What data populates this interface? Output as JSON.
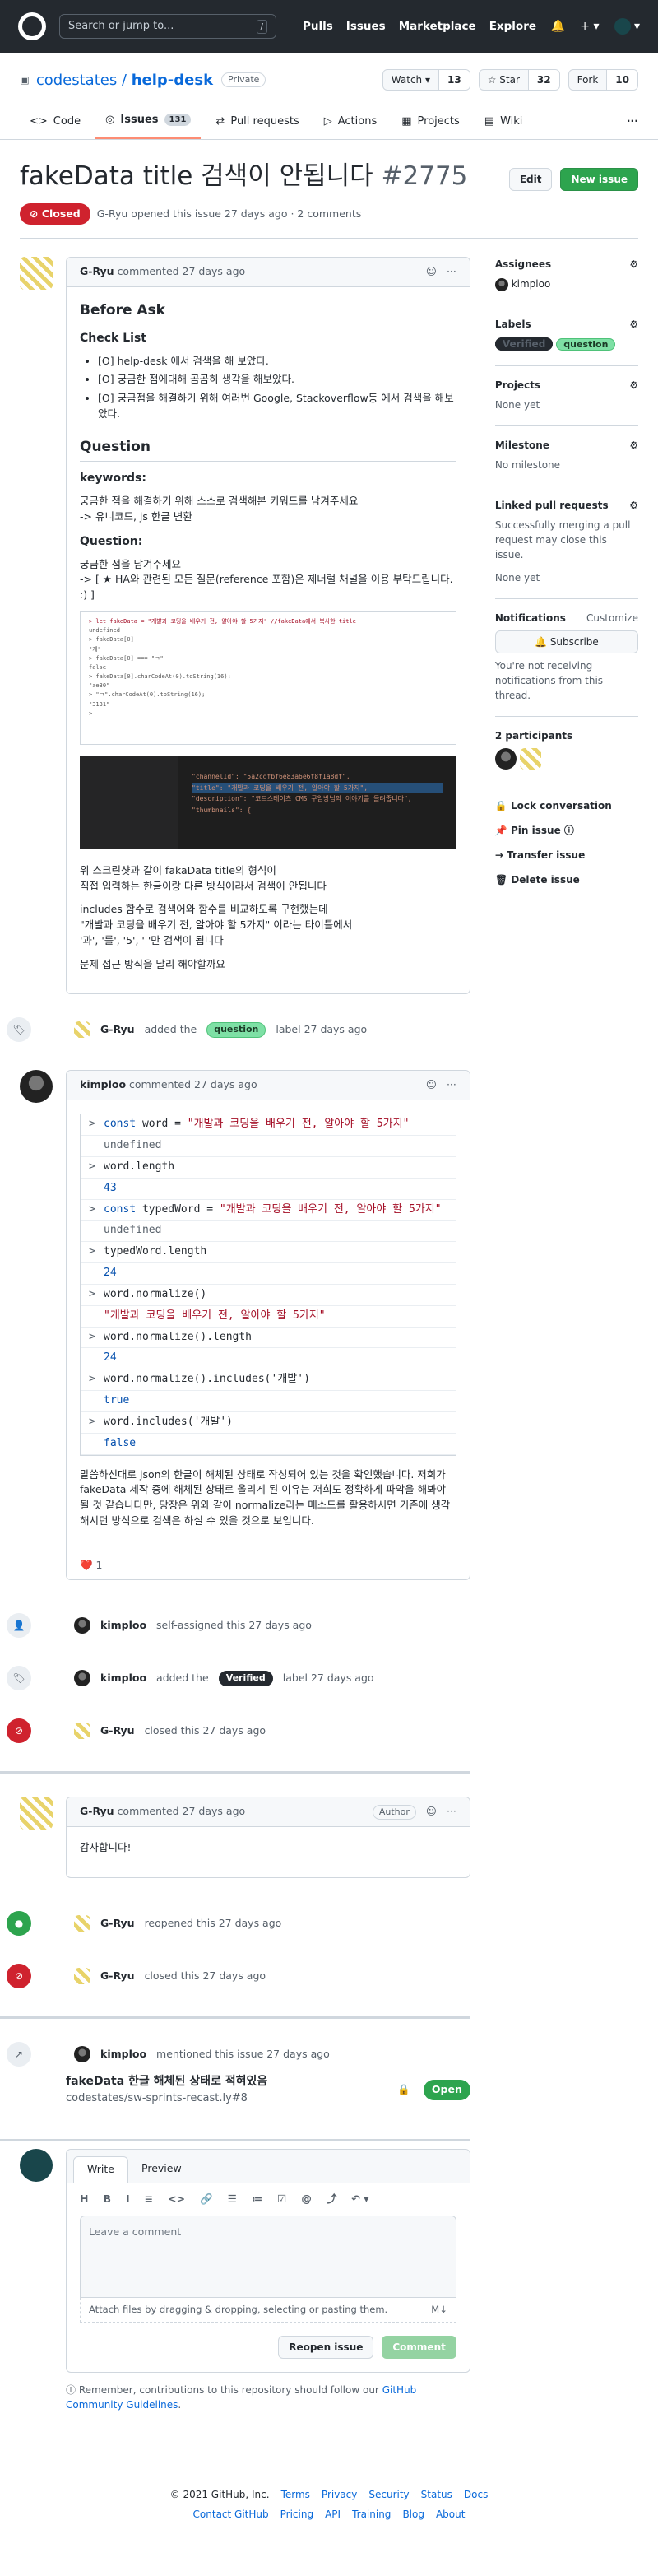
{
  "header": {
    "search_placeholder": "Search or jump to...",
    "search_key": "/",
    "nav": [
      "Pulls",
      "Issues",
      "Marketplace",
      "Explore"
    ],
    "right": [
      "🔔",
      "+ ▾",
      "▾"
    ]
  },
  "repo": {
    "owner": "codestates",
    "slash": " / ",
    "name": "help-desk",
    "visibility": "Private",
    "watch": "Watch ▾",
    "watch_count": "13",
    "star": "☆ Star",
    "star_count": "32",
    "fork": "Fork",
    "fork_count": "10"
  },
  "tabs": [
    {
      "label": "Code"
    },
    {
      "label": "Issues",
      "count": "131"
    },
    {
      "label": "Pull requests"
    },
    {
      "label": "Actions"
    },
    {
      "label": "Projects"
    },
    {
      "label": "Wiki"
    }
  ],
  "tab_icons": [
    "<>",
    "◎",
    "⇄",
    "▷",
    "▦",
    "▤"
  ],
  "more": "···",
  "issue": {
    "title": "fakeData title 검색이 안됩니다",
    "number": "#2775",
    "edit": "Edit",
    "new_issue": "New issue",
    "state": "Closed",
    "opened_text": "G-Ryu opened this issue 27 days ago · 2 comments"
  },
  "comment1": {
    "author": "G-Ryu",
    "time": "commented 27 days ago",
    "more": "···",
    "smile": "☺",
    "h_before": "Before Ask",
    "h_checklist": "Check List",
    "checklist": [
      "[O] help-desk 에서 검색을 해 보았다.",
      "[O] 궁금한 점에대해 곰곰히 생각을 해보았다.",
      "[O] 궁금점을 해결하기 위해 여러번 Google, Stackoverflow등 에서 검색을 해보았다."
    ],
    "h_question": "Question",
    "kw_label": "keywords:",
    "kw_line1": "궁금한 점을 해결하기 위해 스스로 검색해본 키워드를 남겨주세요",
    "kw_line2": "-> 유니코드, js 한글 변환",
    "q_label": "Question:",
    "q_line1": "궁금한 점을 남겨주세요",
    "q_line2": "-> [ ★ HA와 관련된 모든 질문(reference 포함)은 제너럴 채널을 이용 부탁드립니다. :) ]",
    "img1_lines": [
      "> let fakeData = \"개발과 코딩을 배우기 전, 알아야 할 5가지\" //fakeData에서 복사한 title",
      "  undefined",
      "> fakeData[0]",
      "  \"개\"",
      "> fakeData[0] === \"ㄱ\"",
      "  false",
      "> fakeData[0].charCodeAt(0).toString(16);",
      "  \"ae30\"",
      "> \"ㄱ\".charCodeAt(0).toString(16);",
      "  \"3131\"",
      ">"
    ],
    "img2_lines": [
      "\"channelId\": \"5a2cdfbf6e83a6e6f8f1a8df\",",
      "\"title\": \"개발과 코딩을 배우기 전, 알아야 할 5가지\",",
      "\"description\": \"코드스테이츠 CMS 구임방님의 이야기를 들려줍니다\",",
      "\"thumbnails\": {"
    ],
    "p1": "위 스크린샷과 같이 fakaData title의 형식이",
    "p2": "직접 입력하는 한글이랑 다른 방식이라서 검색이 안됩니다",
    "p3": "includes 함수로 검색어와 함수를 비교하도록 구현했는데",
    "p4": "\"개발과 코딩을 배우기 전, 알아야 할 5가지\" 이라는 타이틀에서",
    "p5": "'과', '를', '5', ' '만 검색이 됩니다",
    "p6": "문제 접근 방식을 달리 해야할까요"
  },
  "event_label1": {
    "icon": "🏷",
    "user": "G-Ryu",
    "pre": "added the",
    "label": "question",
    "post": "label 27 days ago"
  },
  "comment2": {
    "author": "kimploo",
    "time": "commented 27 days ago",
    "more": "···",
    "smile": "☺",
    "console": [
      {
        "k": "in",
        "p": ">",
        "t1": "const ",
        "t2": "word = ",
        "t3": "\"개발과 코딩을 배우기 전, 알아야 할 5가지\""
      },
      {
        "k": "out",
        "p": "",
        "t": "undefined"
      },
      {
        "k": "in",
        "p": ">",
        "t": "word.length"
      },
      {
        "k": "num",
        "p": "",
        "t": "43"
      },
      {
        "k": "in",
        "p": ">",
        "t1": "const ",
        "t2": "typedWord = ",
        "t3": "\"개발과 코딩을 배우기 전, 알아야 할 5가지\""
      },
      {
        "k": "out",
        "p": "",
        "t": "undefined"
      },
      {
        "k": "in",
        "p": ">",
        "t": "typedWord.length"
      },
      {
        "k": "num",
        "p": "",
        "t": "24"
      },
      {
        "k": "in",
        "p": ">",
        "t": "word.normalize()"
      },
      {
        "k": "ostr",
        "p": "",
        "t": "\"개발과 코딩을 배우기 전, 알아야 할 5가지\""
      },
      {
        "k": "in",
        "p": ">",
        "t": "word.normalize().length"
      },
      {
        "k": "num",
        "p": "",
        "t": "24"
      },
      {
        "k": "in",
        "p": ">",
        "t": "word.normalize().includes('개발')"
      },
      {
        "k": "bool",
        "p": "",
        "t": "true"
      },
      {
        "k": "in",
        "p": ">",
        "t": "word.includes('개발')"
      },
      {
        "k": "bool",
        "p": "",
        "t": "false"
      }
    ],
    "para": "말씀하신대로 json의 한글이 해체된 상태로 작성되어 있는 것을 확인했습니다. 저희가 fakeData 제작 중에 해체된 상태로 올리게 된 이유는 저희도 정확하게 파악을 해봐야 될 것 같습니다만, 당장은 위와 같이 normalize라는 메소드를 활용하시면 기존에 생각해시던 방식으로 검색은 하실 수 있을 것으로 보입니다.",
    "reaction": "❤️ 1"
  },
  "events": [
    {
      "icon": "👤",
      "cls": "",
      "user": "kimploo",
      "text": "self-assigned this 27 days ago"
    },
    {
      "icon": "🏷",
      "cls": "",
      "user": "kimploo",
      "pre": "added the",
      "label": "Verified",
      "post": "label 27 days ago"
    },
    {
      "icon": "⊘",
      "cls": "red",
      "user": "G-Ryu",
      "text": "closed this 27 days ago"
    }
  ],
  "comment3": {
    "author": "G-Ryu",
    "time": "commented 27 days ago",
    "badge": "Author",
    "smile": "☺",
    "more": "···",
    "body": "감사합니다!"
  },
  "events2": [
    {
      "icon": "●",
      "cls": "grn",
      "user": "G-Ryu",
      "text": "reopened this 27 days ago"
    },
    {
      "icon": "⊘",
      "cls": "red",
      "user": "G-Ryu",
      "text": "closed this 27 days ago"
    }
  ],
  "mention": {
    "icon": "↗",
    "user": "kimploo",
    "text": "mentioned this issue 27 days ago",
    "title": "fakeData 한글 해체된 상태로 적혀있음",
    "ref": "codestates/sw-sprints-recast.ly#8",
    "lock": "🔒",
    "state": "Open"
  },
  "editor": {
    "write": "Write",
    "preview": "Preview",
    "tools": [
      "H",
      "B",
      "I",
      "≡",
      "<>",
      "🔗",
      "☰",
      "≔",
      "☑",
      "@",
      "⤴",
      "↶ ▾"
    ],
    "placeholder": "Leave a comment",
    "attach": "Attach files by dragging & dropping, selecting or pasting them.",
    "md": "M↓",
    "reopen": "Reopen issue",
    "comment": "Comment"
  },
  "note": {
    "icon": "ⓘ",
    "pre": "Remember, contributions to this repository should follow our",
    "link": "GitHub Community Guidelines",
    "post": "."
  },
  "sidebar": {
    "assignees": "Assignees",
    "assignee": "kimploo",
    "labels": "Labels",
    "label_list": [
      "Verified",
      "question"
    ],
    "projects": "Projects",
    "projects_v": "None yet",
    "milestone": "Milestone",
    "milestone_v": "No milestone",
    "linked": "Linked pull requests",
    "linked_desc": "Successfully merging a pull request may close this issue.",
    "linked_v": "None yet",
    "notifications": "Notifications",
    "customize": "Customize",
    "subscribe": "🔔 Subscribe",
    "notif_desc": "You're not receiving notifications from this thread.",
    "participants": "2 participants",
    "actions": [
      {
        "icon": "🔒",
        "t": "Lock conversation"
      },
      {
        "icon": "📌",
        "t": "Pin issue ⓘ"
      },
      {
        "icon": "→",
        "t": "Transfer issue"
      },
      {
        "icon": "🗑",
        "t": "Delete issue"
      }
    ],
    "gear": "⚙"
  },
  "footer": {
    "row1": [
      "© 2021 GitHub, Inc.",
      "Terms",
      "Privacy",
      "Security",
      "Status",
      "Docs"
    ],
    "row2": [
      "Contact GitHub",
      "Pricing",
      "API",
      "Training",
      "Blog",
      "About"
    ]
  }
}
